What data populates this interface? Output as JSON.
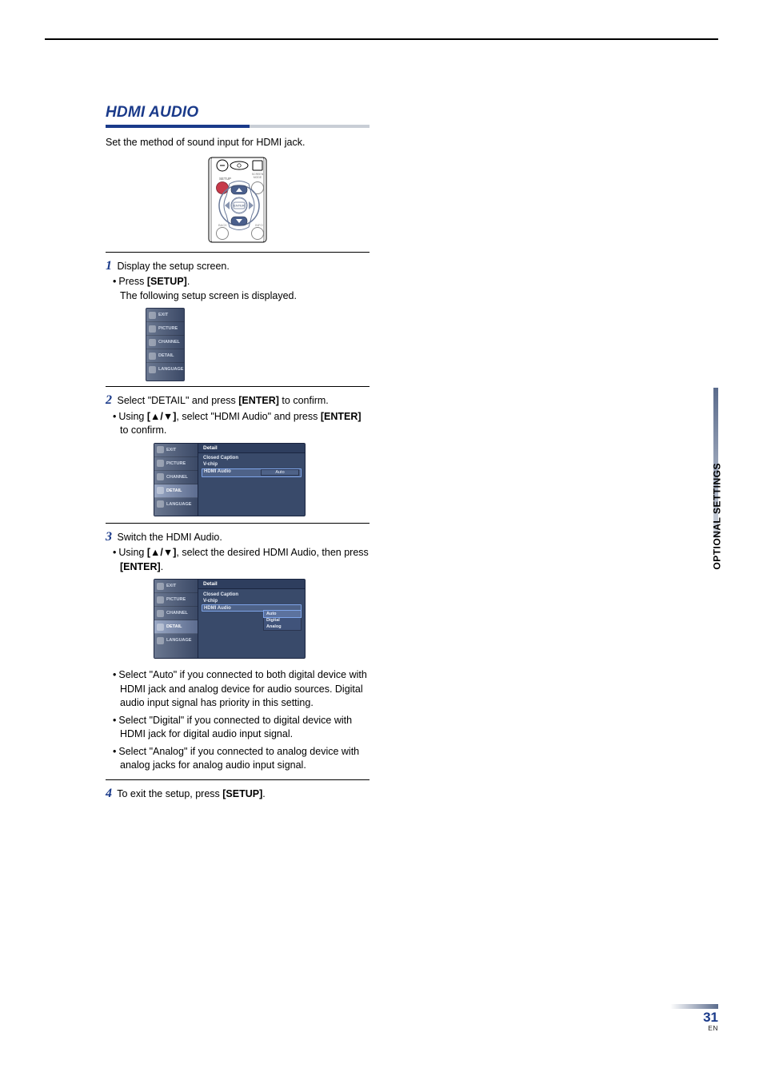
{
  "section": {
    "title": "HDMI AUDIO",
    "intro": "Set the method of sound input for HDMI jack."
  },
  "remote": {
    "labels": {
      "setup": "SETUP",
      "screen_mode": "SCREEN MODE",
      "back": "BACK",
      "info": "INFO",
      "enter": "ENTER"
    }
  },
  "steps": {
    "s1": {
      "text": "Display the setup screen.",
      "bullet1_pre": "Press ",
      "bullet1_key": "[SETUP]",
      "bullet1_post": ".",
      "line2": "The following setup screen is displayed."
    },
    "s2": {
      "text_pre": "Select \"DETAIL\" and press ",
      "text_key": "[ENTER]",
      "text_post": " to confirm.",
      "bullet1_pre": "Using ",
      "bullet1_key": "[▲/▼]",
      "bullet1_mid": ", select \"HDMI Audio\" and press ",
      "bullet1_key2": "[ENTER]",
      "bullet1_post": " to confirm."
    },
    "s3": {
      "text": "Switch the HDMI Audio.",
      "bullet1_pre": "Using ",
      "bullet1_key": "[▲/▼]",
      "bullet1_mid": ", select the desired HDMI Audio, then press ",
      "bullet1_key2": "[ENTER]",
      "bullet1_post": ".",
      "note_auto": "Select \"Auto\" if you connected to both digital device with HDMI jack and analog device for audio sources. Digital audio input signal has priority in this setting.",
      "note_digital": "Select \"Digital\" if you connected to digital device with HDMI jack for digital audio input signal.",
      "note_analog": "Select \"Analog\" if you connected to analog device with analog jacks for analog audio input signal."
    },
    "s4": {
      "text_pre": "To exit the setup, press ",
      "text_key": "[SETUP]",
      "text_post": "."
    }
  },
  "osd": {
    "menu": [
      "EXIT",
      "PICTURE",
      "CHANNEL",
      "DETAIL",
      "LANGUAGE"
    ],
    "detail_panel": {
      "title": "Detail",
      "items": [
        "Closed Caption",
        "V-chip",
        "HDMI Audio"
      ],
      "hdmi_value": "Auto",
      "options": [
        "Auto",
        "Digital",
        "Analog"
      ]
    }
  },
  "side_tab": "OPTIONAL SETTINGS",
  "page_number": "31",
  "page_lang": "EN"
}
